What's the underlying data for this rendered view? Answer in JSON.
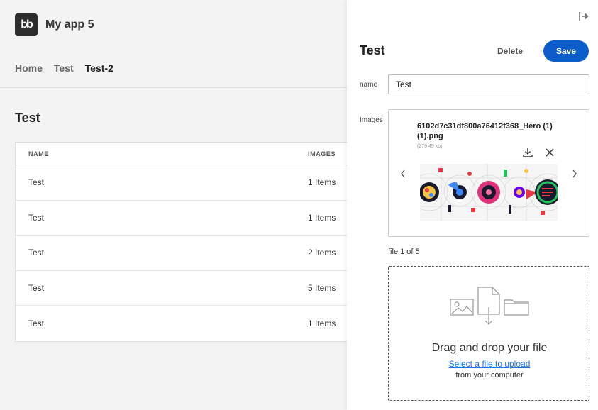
{
  "app": {
    "logo_text": "bb",
    "title": "My app 5",
    "nav": [
      "Home",
      "Test",
      "Test-2"
    ],
    "active_nav": "Test-2"
  },
  "page": {
    "title": "Test",
    "columns": [
      "NAME",
      "IMAGES"
    ],
    "rows": [
      {
        "name": "Test",
        "images": "1 Items"
      },
      {
        "name": "Test",
        "images": "1 Items"
      },
      {
        "name": "Test",
        "images": "2 Items"
      },
      {
        "name": "Test",
        "images": "5 Items"
      },
      {
        "name": "Test",
        "images": "1 Items"
      }
    ]
  },
  "drawer": {
    "title": "Test",
    "delete_label": "Delete",
    "save_label": "Save",
    "name_label": "name",
    "name_value": "Test",
    "images_label": "Images",
    "file_name": "6102d7c31df800a76412f368_Hero (1) (1).png",
    "file_size": "(279.49 kb)",
    "file_count": "file 1 of 5",
    "dropzone_title": "Drag and drop your file",
    "dropzone_link": "Select a file to upload",
    "dropzone_sub": "from your computer"
  },
  "colors": {
    "accent": "#0b5dcb",
    "link": "#1a73e8"
  },
  "icons": [
    "close-drawer-icon",
    "download-icon",
    "close-icon",
    "chevron-left-icon",
    "chevron-right-icon",
    "image-icon",
    "file-icon",
    "folder-icon"
  ]
}
